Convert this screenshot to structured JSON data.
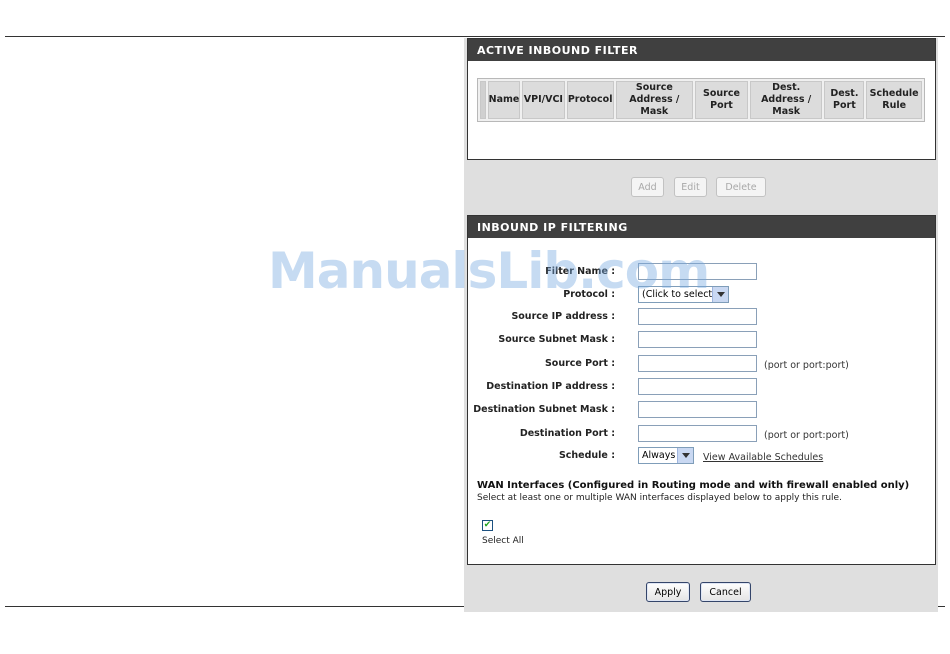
{
  "active_filter": {
    "title": "ACTIVE INBOUND FILTER",
    "columns": [
      "Name",
      "VPI/VCI",
      "Protocol",
      "Source Address / Mask",
      "Source Port",
      "Dest. Address / Mask",
      "Dest. Port",
      "Schedule Rule"
    ],
    "buttons": {
      "add": "Add",
      "edit": "Edit",
      "delete": "Delete"
    }
  },
  "inbound_filtering": {
    "title": "INBOUND IP FILTERING",
    "fields": {
      "filter_name": {
        "label": "Filter Name :",
        "value": ""
      },
      "protocol": {
        "label": "Protocol :",
        "selected": "(Click to select)"
      },
      "source_ip": {
        "label": "Source IP address :",
        "value": ""
      },
      "source_mask": {
        "label": "Source Subnet Mask :",
        "value": ""
      },
      "source_port": {
        "label": "Source Port :",
        "value": "",
        "hint": "(port or port:port)"
      },
      "dest_ip": {
        "label": "Destination IP address :",
        "value": ""
      },
      "dest_mask": {
        "label": "Destination Subnet Mask :",
        "value": ""
      },
      "dest_port": {
        "label": "Destination Port :",
        "value": "",
        "hint": "(port or port:port)"
      },
      "schedule": {
        "label": "Schedule :",
        "selected": "Always",
        "link": "View Available Schedules"
      }
    },
    "wan": {
      "title": "WAN Interfaces (Configured in Routing mode and with firewall enabled only)",
      "description": "Select at least one or multiple WAN interfaces displayed below to apply this rule.",
      "select_all_label": "Select All",
      "select_all_checked": true,
      "check_glyph": "✔"
    }
  },
  "footer_buttons": {
    "apply": "Apply",
    "cancel": "Cancel"
  },
  "watermark": "ManualsLib.com"
}
